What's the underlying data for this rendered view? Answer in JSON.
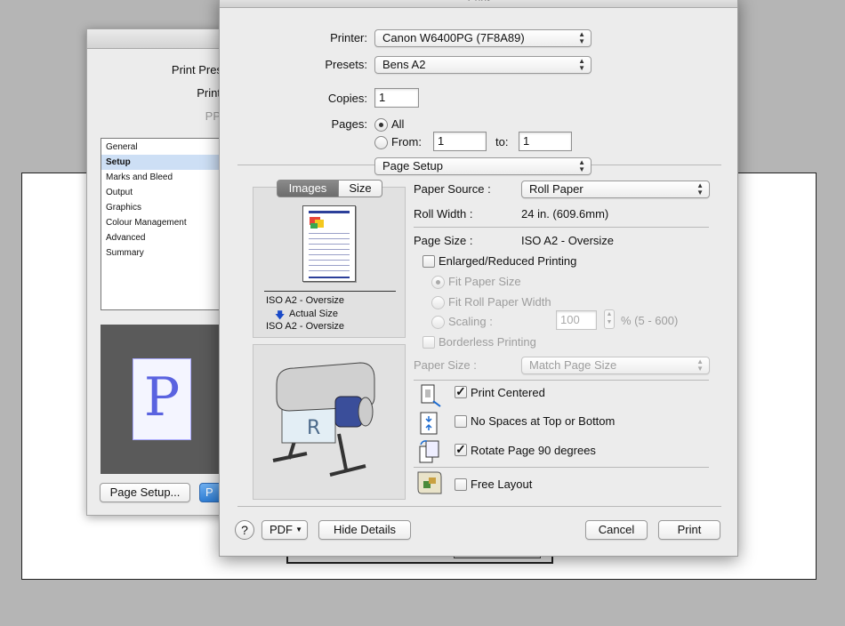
{
  "back_dialog": {
    "labels": [
      "Print Pres",
      "Print",
      "PP"
    ],
    "categories": [
      {
        "label": "General",
        "selected": false
      },
      {
        "label": "Setup",
        "selected": true
      },
      {
        "label": "Marks and Bleed",
        "selected": false
      },
      {
        "label": "Output",
        "selected": false
      },
      {
        "label": "Graphics",
        "selected": false
      },
      {
        "label": "Colour Management",
        "selected": false
      },
      {
        "label": "Advanced",
        "selected": false
      },
      {
        "label": "Summary",
        "selected": false
      }
    ],
    "preview_letter": "P",
    "page_setup_button": "Page Setup...",
    "blue_button_partial": "P"
  },
  "print_dialog": {
    "title": "Print",
    "printer_label": "Printer:",
    "printer_value": "Canon W6400PG (7F8A89)",
    "presets_label": "Presets:",
    "presets_value": "Bens A2",
    "copies_label": "Copies:",
    "copies_value": "1",
    "pages_label": "Pages:",
    "pages_all": "All",
    "pages_from": "From:",
    "pages_from_value": "1",
    "pages_to": "to:",
    "pages_to_value": "1",
    "section_popup": "Page Setup",
    "tabs": {
      "images": "Images",
      "size": "Size"
    },
    "preview": {
      "line1": "ISO A2 - Oversize",
      "line2": "Actual Size",
      "line3": "ISO A2 - Oversize"
    },
    "paper_source_label": "Paper Source :",
    "paper_source_value": "Roll Paper",
    "roll_width_label": "Roll Width :",
    "roll_width_value": "24 in. (609.6mm)",
    "page_size_label": "Page Size :",
    "page_size_value": "ISO A2 - Oversize",
    "enlarged_reduced": "Enlarged/Reduced Printing",
    "fit_paper_size": "Fit Paper Size",
    "fit_roll_paper_width": "Fit Roll Paper Width",
    "scaling_label": "Scaling :",
    "scaling_value": "100",
    "scaling_range": "% (5 - 600)",
    "borderless": "Borderless Printing",
    "paper_size_label": "Paper Size :",
    "paper_size_value": "Match Page Size",
    "print_centered": "Print Centered",
    "no_spaces": "No Spaces at Top or Bottom",
    "rotate": "Rotate Page 90 degrees",
    "free_layout": "Free Layout",
    "help": "?",
    "pdf": "PDF",
    "hide_details": "Hide Details",
    "cancel": "Cancel",
    "print": "Print"
  },
  "state": {
    "pages_all_selected": true,
    "enlarged_reduced_checked": false,
    "fit_paper_size_selected": true,
    "borderless_checked": false,
    "print_centered_checked": true,
    "no_spaces_checked": false,
    "rotate_checked": true,
    "free_layout_checked": false
  },
  "colors": {
    "accent_blue": "#2f7fd6",
    "selection": "#cddff5",
    "preview_letter": "#5a63e0"
  }
}
